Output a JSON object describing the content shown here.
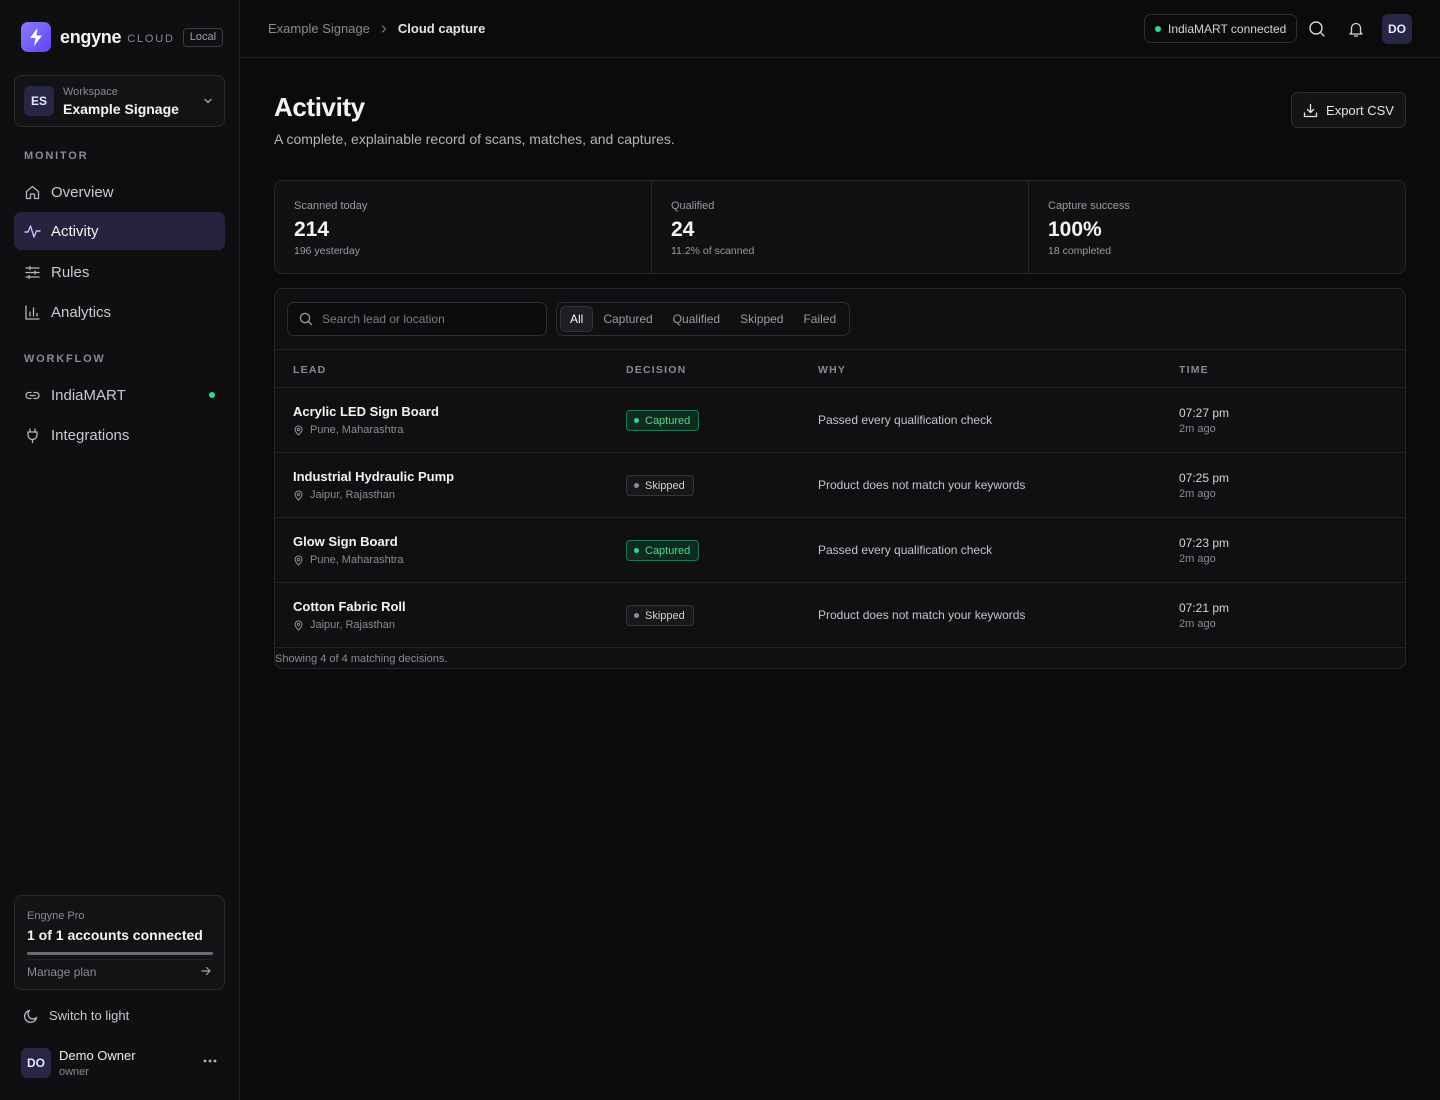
{
  "brand": {
    "name": "engyne",
    "suffix": "CLOUD",
    "badge": "Local"
  },
  "workspace": {
    "initials": "ES",
    "label": "Workspace",
    "name": "Example Signage"
  },
  "nav": {
    "monitor_label": "MONITOR",
    "workflow_label": "WORKFLOW",
    "items": [
      {
        "label": "Overview",
        "icon": "home-icon"
      },
      {
        "label": "Activity",
        "icon": "activity-icon",
        "active": true
      },
      {
        "label": "Rules",
        "icon": "sliders-icon"
      },
      {
        "label": "Analytics",
        "icon": "bar-chart-icon"
      },
      {
        "label": "IndiaMART",
        "icon": "link-icon",
        "status": "connected"
      },
      {
        "label": "Integrations",
        "icon": "plug-icon"
      }
    ]
  },
  "plan": {
    "label": "Engyne Pro",
    "accounts": "1 of 1 accounts connected",
    "usage_fraction": 1.0,
    "manage": "Manage plan"
  },
  "theme_toggle": "Switch to light",
  "user": {
    "initials": "DO",
    "name": "Demo Owner",
    "role": "owner"
  },
  "topbar": {
    "breadcrumb": [
      "Example Signage",
      "Cloud capture"
    ],
    "connection": "IndiaMART connected",
    "avatar": "DO"
  },
  "page": {
    "title": "Activity",
    "subtitle": "A complete, explainable record of scans, matches, and captures.",
    "export_label": "Export CSV"
  },
  "stats": [
    {
      "label": "Scanned today",
      "value": "214",
      "sub": "196 yesterday"
    },
    {
      "label": "Qualified",
      "value": "24",
      "sub": "11.2% of scanned"
    },
    {
      "label": "Capture success",
      "value": "100%",
      "sub": "18 completed"
    }
  ],
  "filters": {
    "search_placeholder": "Search lead or location",
    "tabs": [
      "All",
      "Captured",
      "Qualified",
      "Skipped",
      "Failed"
    ],
    "active": "All"
  },
  "table": {
    "columns": [
      "LEAD",
      "DECISION",
      "WHY",
      "TIME"
    ],
    "rows": [
      {
        "lead": "Acrylic LED Sign Board",
        "location": "Pune, Maharashtra",
        "decision": "Captured",
        "why": "Passed every qualification check",
        "time": "07:27 pm",
        "ago": "2m ago"
      },
      {
        "lead": "Industrial Hydraulic Pump",
        "location": "Jaipur, Rajasthan",
        "decision": "Skipped",
        "why": "Product does not match your keywords",
        "time": "07:25 pm",
        "ago": "2m ago"
      },
      {
        "lead": "Glow Sign Board",
        "location": "Pune, Maharashtra",
        "decision": "Captured",
        "why": "Passed every qualification check",
        "time": "07:23 pm",
        "ago": "2m ago"
      },
      {
        "lead": "Cotton Fabric Roll",
        "location": "Jaipur, Rajasthan",
        "decision": "Skipped",
        "why": "Product does not match your keywords",
        "time": "07:21 pm",
        "ago": "2m ago"
      }
    ],
    "footer": "Showing 4 of 4 matching decisions."
  },
  "colors": {
    "accent": "#6d5cf5",
    "success": "#34d399",
    "background": "#0b0b0c"
  }
}
